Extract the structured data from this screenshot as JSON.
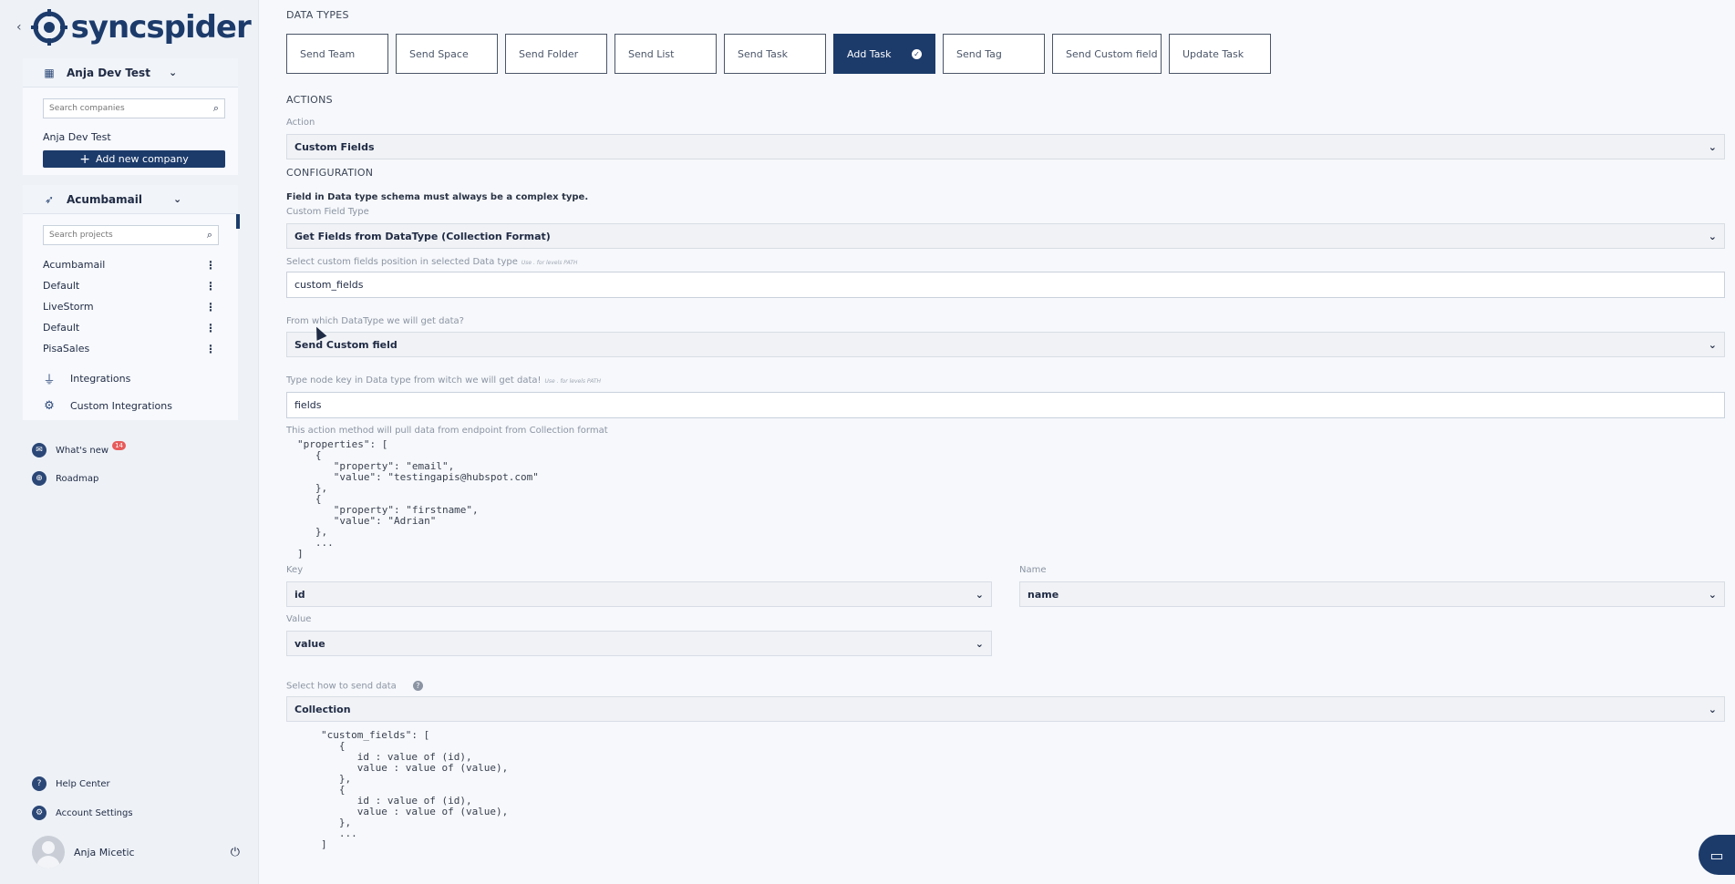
{
  "brand": {
    "name": "syncspider"
  },
  "sidebar": {
    "company": {
      "name": "Anja Dev Test",
      "search_placeholder": "Search companies",
      "current": "Anja Dev Test",
      "add_label": "Add new company"
    },
    "project": {
      "name": "Acumbamail",
      "search_placeholder": "Search projects",
      "items": [
        "Acumbamail",
        "Default",
        "LiveStorm",
        "Default",
        "PisaSales"
      ]
    },
    "links": {
      "integrations": "Integrations",
      "custom_integrations": "Custom Integrations"
    },
    "nav": {
      "whats_new": "What's new",
      "whats_new_badge": "14",
      "roadmap": "Roadmap"
    },
    "footer": {
      "help": "Help Center",
      "account": "Account Settings",
      "user": "Anja Micetic"
    }
  },
  "main": {
    "data_types_title": "DATA TYPES",
    "tabs": [
      "Send Team",
      "Send Space",
      "Send Folder",
      "Send List",
      "Send Task",
      "Add Task",
      "Send Tag",
      "Send Custom field",
      "Update Task"
    ],
    "actions_title": "ACTIONS",
    "action_label": "Action",
    "action_value": "Custom Fields",
    "config_title": "CONFIGURATION",
    "note": "Field in Data type schema must always be a complex type.",
    "cf_type_label": "Custom Field Type",
    "cf_type_value": "Get Fields from DataType (Collection Format)",
    "position_label": "Select custom fields position in selected Data type",
    "position_hint": "Use . for levels PATH",
    "position_value": "custom_fields",
    "from_label": "From which DataType we will get data?",
    "from_value": "Send Custom field",
    "node_label": "Type node key in Data type from witch we will get data!",
    "node_hint": "Use . for levels PATH",
    "node_value": "fields",
    "collection_note": "This action method will pull data from endpoint from Collection format",
    "example_code": "\"properties\": [\n   {\n      \"property\": \"email\",\n      \"value\": \"testingapis@hubspot.com\"\n   },\n   {\n      \"property\": \"firstname\",\n      \"value\": \"Adrian\"\n   },\n   ...\n]",
    "key_label": "Key",
    "key_value": "id",
    "name_label": "Name",
    "name_value": "name",
    "value_label": "Value",
    "value_value": "value",
    "send_label": "Select how to send data",
    "send_value": "Collection",
    "output_code": "\"custom_fields\": [\n   {\n      id : value of (id),\n      value : value of (value),\n   },\n   {\n      id : value of (id),\n      value : value of (value),\n   },\n   ...\n]"
  },
  "colors": {
    "brand_dark": "#1c3b6b",
    "badge": "#e85a5a"
  }
}
